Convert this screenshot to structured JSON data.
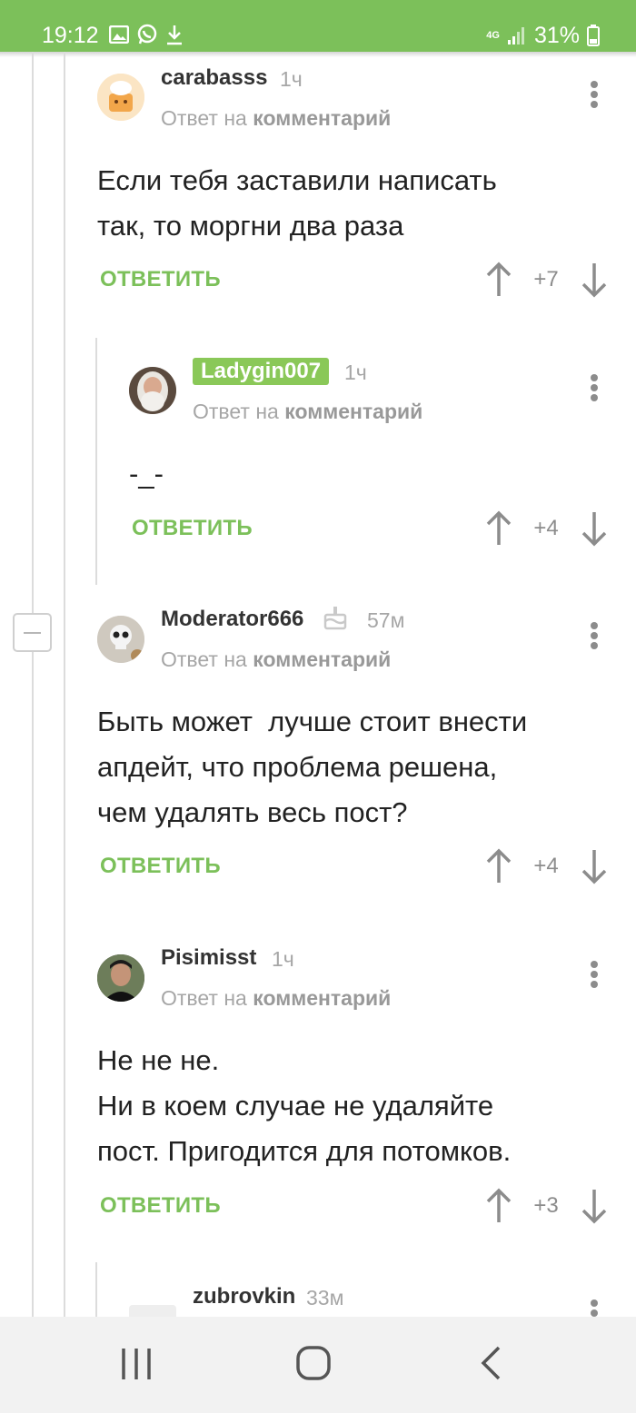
{
  "status_bar": {
    "time": "19:12",
    "network": "4G",
    "battery": "31%",
    "icons": [
      "gallery-icon",
      "whatsapp-icon",
      "download-icon",
      "signal-icon",
      "battery-icon"
    ]
  },
  "colors": {
    "accent": "#7cc05a",
    "muted": "#a6a6a6",
    "text": "#222222"
  },
  "comments": [
    {
      "author": "carabasss",
      "time": "1ч",
      "reply_prefix": "Ответ на",
      "reply_target": "комментарий",
      "text_lines": [
        "Если тебя заставили написать",
        "так, то моргни два раза"
      ],
      "reply_label": "ОТВЕТИТЬ",
      "score": "+7"
    },
    {
      "author": "Ladygin007",
      "time": "1ч",
      "reply_prefix": "Ответ на",
      "reply_target": "комментарий",
      "text_lines": [
        "-_-"
      ],
      "reply_label": "ОТВЕТИТЬ",
      "score": "+4"
    },
    {
      "author": "Moderator666",
      "time": "57м",
      "reply_prefix": "Ответ на",
      "reply_target": "комментарий",
      "text_lines": [
        "Быть может  лучше стоит внести",
        "апдейт, что проблема решена,",
        "чем удалять весь пост?"
      ],
      "reply_label": "ОТВЕТИТЬ",
      "score": "+4"
    },
    {
      "author": "Pisimisst",
      "time": "1ч",
      "reply_prefix": "Ответ на",
      "reply_target": "комментарий",
      "text_lines": [
        "Не не не.",
        "Ни в коем случае не удаляйте",
        "пост. Пригодится для потомков."
      ],
      "reply_label": "ОТВЕТИТЬ",
      "score": "+3"
    },
    {
      "author": "zubrovkin",
      "time": "33м"
    }
  ]
}
